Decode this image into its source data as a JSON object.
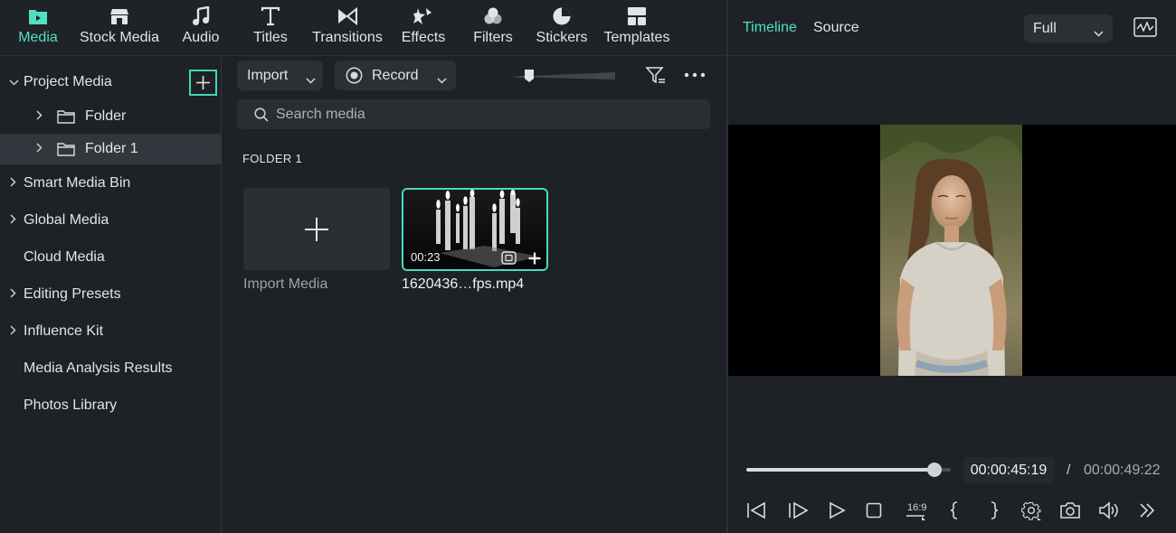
{
  "toolbar": {
    "items": [
      {
        "label": "Media",
        "icon": "media-icon",
        "active": true
      },
      {
        "label": "Stock Media",
        "icon": "stock-media-icon"
      },
      {
        "label": "Audio",
        "icon": "music-note-icon"
      },
      {
        "label": "Titles",
        "icon": "titles-icon"
      },
      {
        "label": "Transitions",
        "icon": "transitions-icon"
      },
      {
        "label": "Effects",
        "icon": "effects-icon"
      },
      {
        "label": "Filters",
        "icon": "filters-icon"
      },
      {
        "label": "Stickers",
        "icon": "stickers-icon"
      },
      {
        "label": "Templates",
        "icon": "templates-icon"
      }
    ]
  },
  "sidebar": {
    "project_media": "Project Media",
    "folders": [
      "Folder",
      "Folder 1"
    ],
    "items": [
      "Smart Media Bin",
      "Global Media",
      "Cloud Media",
      "Editing Presets",
      "Influence Kit",
      "Media Analysis Results",
      "Photos Library"
    ]
  },
  "media": {
    "import_label": "Import",
    "record_label": "Record",
    "search_placeholder": "Search media",
    "folder_heading": "FOLDER 1",
    "import_media_label": "Import Media",
    "clip": {
      "name": "1620436…fps.mp4",
      "duration": "00:23"
    }
  },
  "preview": {
    "tab_timeline": "Timeline",
    "tab_source": "Source",
    "zoom": "Full",
    "progress": 0.92,
    "time_current": "00:00:45:19",
    "time_separator": "/",
    "time_total": "00:00:49:22",
    "aspect_label": "16:9"
  },
  "colors": {
    "accent": "#4fe0c3",
    "panel": "#1e2126",
    "selection": "#33373d"
  }
}
